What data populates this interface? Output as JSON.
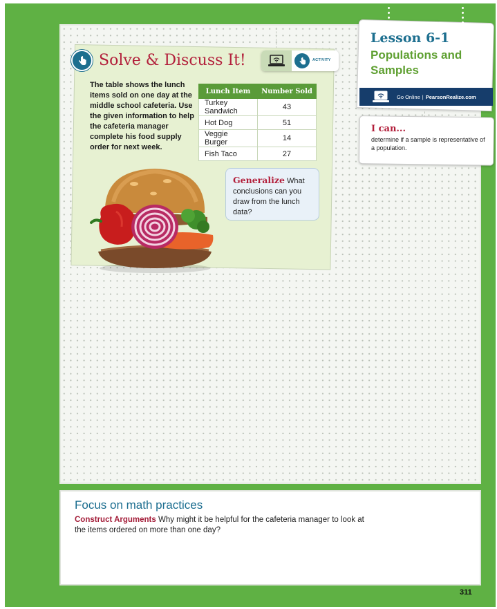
{
  "solve": {
    "title": "Solve & Discuss It!",
    "activity_label": "ACTIVITY",
    "prompt": "The table shows the lunch items sold on one day at the middle school cafeteria. Use the given information to help the cafeteria manager complete his food supply order for next week."
  },
  "table": {
    "headers": [
      "Lunch Item",
      "Number Sold"
    ],
    "rows": [
      {
        "item": "Turkey Sandwich",
        "sold": "43"
      },
      {
        "item": "Hot Dog",
        "sold": "51"
      },
      {
        "item": "Veggie Burger",
        "sold": "14"
      },
      {
        "item": "Fish Taco",
        "sold": "27"
      }
    ]
  },
  "generalize": {
    "lead": "Generalize",
    "text": "What conclusions can you draw from the lunch data?"
  },
  "lesson": {
    "number": "Lesson 6-1",
    "title": "Populations and Samples",
    "go_online": "Go Online",
    "separator": "|",
    "brand": "PearsonRealize.com"
  },
  "ican": {
    "title": "I can...",
    "text": "determine if a sample is representative of a population."
  },
  "focus": {
    "title": "Focus on math practices",
    "lead": "Construct Arguments",
    "text": "Why might it be helpful for the cafeteria manager to look at the items ordered on more than one day?"
  },
  "page_number": "311",
  "icons": [
    "hand-pointer-icon",
    "laptop-wifi-icon"
  ],
  "colors": {
    "page_green": "#5fb144",
    "title_red": "#b21e3a",
    "lesson_blue": "#1d6f8f",
    "lesson_green": "#5fa032",
    "online_bar": "#163d6b",
    "table_header": "#5a9b39"
  }
}
